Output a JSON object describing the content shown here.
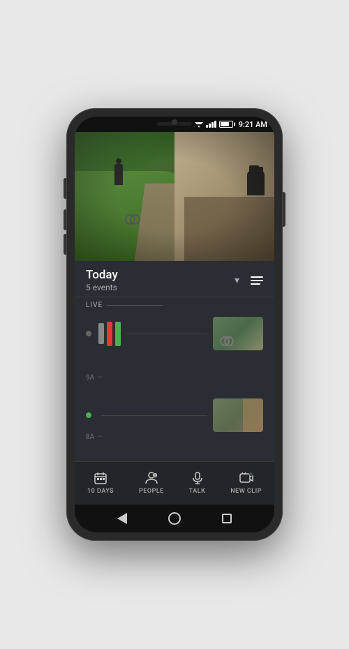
{
  "phone": {
    "status_bar": {
      "time": "9:21 AM"
    },
    "camera": {
      "alt": "Outdoor security camera view showing yard and porch"
    },
    "header": {
      "title": "Today",
      "subtitle": "5 events",
      "chevron_label": "▾",
      "menu_label": "menu"
    },
    "timeline": {
      "live_label": "LIVE",
      "time_labels": [
        "9A",
        "8A"
      ],
      "events": [
        {
          "id": "event-1",
          "type": "motion_with_person",
          "dot_color": "gray",
          "thumbnail_alt": "Bike in yard thumbnail"
        },
        {
          "id": "event-2",
          "type": "motion",
          "dot_color": "green",
          "thumbnail_alt": "Porch area thumbnail"
        }
      ]
    },
    "toolbar": {
      "items": [
        {
          "id": "10days",
          "icon": "calendar",
          "label": "10 DAYS"
        },
        {
          "id": "people",
          "icon": "person",
          "label": "PEOPLE"
        },
        {
          "id": "talk",
          "icon": "mic",
          "label": "TALK"
        },
        {
          "id": "newclip",
          "icon": "clip",
          "label": "NEW CLIP"
        }
      ]
    },
    "nav": {
      "back_label": "back",
      "home_label": "home",
      "recents_label": "recents"
    }
  }
}
